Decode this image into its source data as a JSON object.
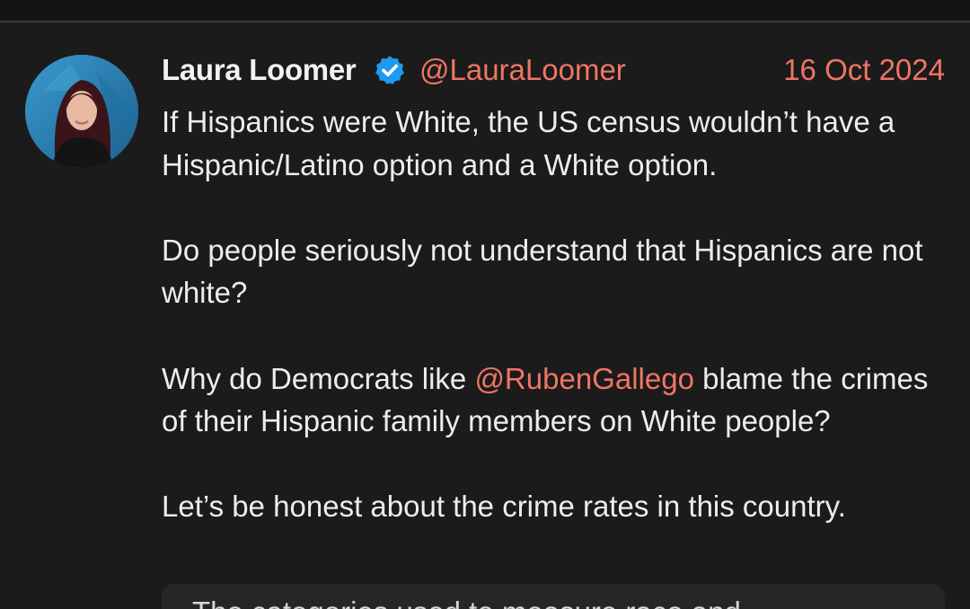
{
  "tweet": {
    "display_name": "Laura Loomer",
    "handle": "@LauraLoomer",
    "date": "16 Oct 2024",
    "verified": true,
    "avatar_icon": "user-avatar",
    "paragraphs": [
      {
        "text": "If Hispanics were White, the US census wouldn’t have a Hispanic/Latino option and a White option."
      },
      {
        "text": "Do people seriously not understand that Hispanics are not white?"
      },
      {
        "before": "Why do Democrats like ",
        "mention": "@RubenGallego",
        "after": " blame the crimes of their Hispanic family members on White people?"
      },
      {
        "text": "Let’s be honest about the crime rates in this country."
      }
    ],
    "quoted_preview": "The categories used to measure race and"
  },
  "colors": {
    "background": "#1b1b1b",
    "accent": "#ef7565",
    "verified_badge": "#1d9bf0",
    "text": "#ededed"
  }
}
